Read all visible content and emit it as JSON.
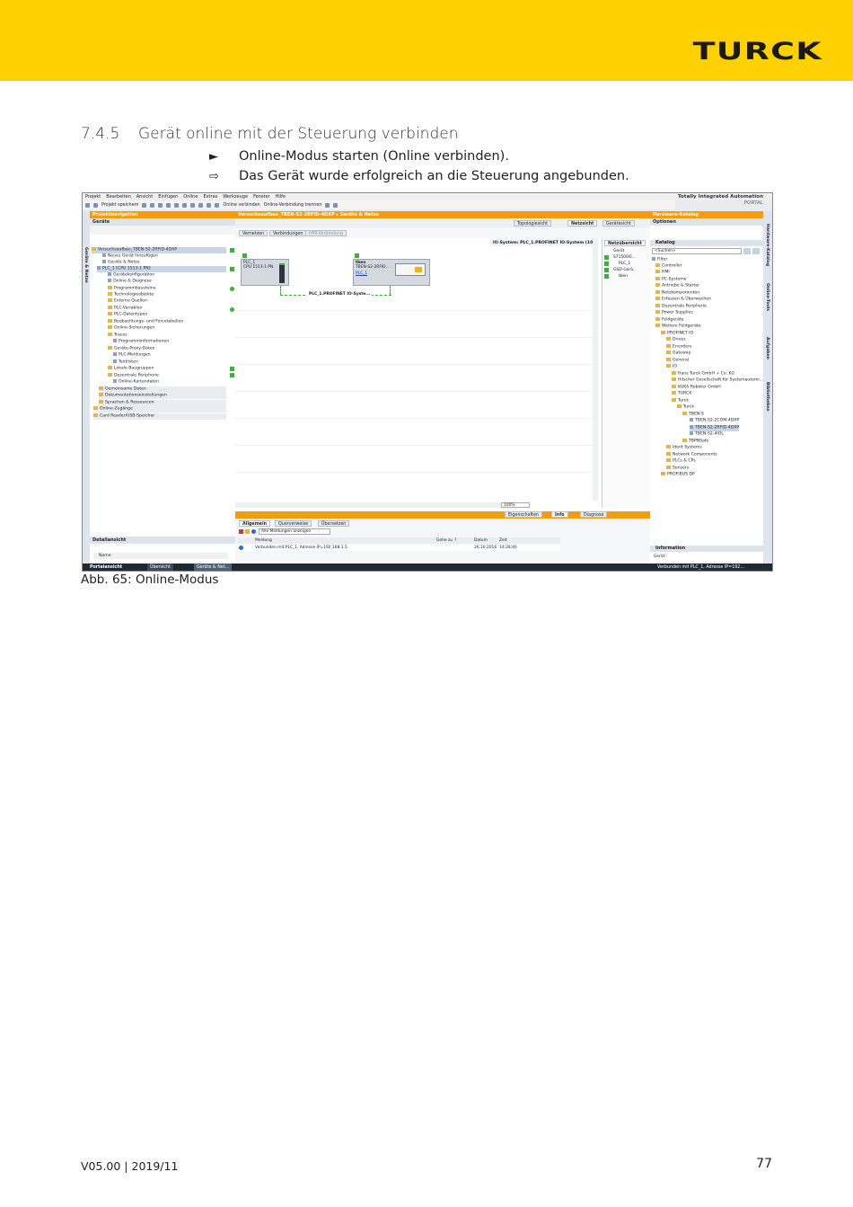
{
  "brand": {
    "logo": "TURCK"
  },
  "section": {
    "number": "7.4.5",
    "title": "Gerät online mit der Steuerung verbinden"
  },
  "steps": [
    {
      "marker": "►",
      "text": "Online-Modus starten (Online verbinden)."
    },
    {
      "marker": "⇨",
      "text": "Das Gerät wurde erfolgreich an die Steuerung angebunden."
    }
  ],
  "caption": "Abb. 65: Online-Modus",
  "footer": {
    "version": "V05.00 | 2019/11",
    "page": "77"
  },
  "screenshot": {
    "menu": [
      "Projekt",
      "Bearbeiten",
      "Ansicht",
      "Einfügen",
      "Online",
      "Extras",
      "Werkzeuge",
      "Fenster",
      "Hilfe"
    ],
    "brand_line1": "Totally Integrated Automation",
    "brand_line2": "PORTAL",
    "toolbar": {
      "save": "Projekt speichern",
      "connect": "Online verbinden",
      "disconnect": "Online-Verbindung trennen"
    },
    "project_nav": {
      "title": "Projektnavigation",
      "subtitle": "Geräte",
      "side_tab": "Geräte & Netze",
      "items": [
        "Versuchsaufbau_TBEN-S2-2RFID-4DXP",
        "Neues Gerät hinzufügen",
        "Geräte & Netze",
        "PLC_1 [CPU 1513-1 PN]",
        "Gerätekonfiguration",
        "Online & Diagnose",
        "Programmbausteine",
        "Technologieobjekte",
        "Externe Quellen",
        "PLC-Variablen",
        "PLC-Datentypen",
        "Beobachtungs- und Forcetabellen",
        "Online-Sicherungen",
        "Traces",
        "Programminformationen",
        "Geräte-Proxy-Daten",
        "PLC-Meldungen",
        "Textlisten",
        "Lokale Baugruppen",
        "Dezentrale Peripherie",
        "Online-Kartendaten",
        "Gemeinsame Daten",
        "Dokumentationseinstellungen",
        "Sprachen & Ressourcen",
        "Online-Zugänge",
        "Card Reader/USB-Speicher"
      ],
      "detail_title": "Detailansicht",
      "detail_col": "Name"
    },
    "editor": {
      "title": "Versuchsaufbau_TBEN-S2-2RFID-4DXP ▸ Geräte & Netze",
      "tabs": [
        "Topologiesicht",
        "Netzsicht",
        "Gerätesicht"
      ],
      "toolbar": [
        "Vernetzen",
        "Verbindungen",
        "HMI-Verbindung"
      ],
      "io_system": "IO-System: PLC_1.PROFINET IO-System (100)",
      "net_tab": "Netzübersicht",
      "net_col": "Gerät",
      "net_rows": [
        "S71500/E...",
        "PLC_1",
        "GSD-Gerä...",
        "tben"
      ],
      "plc_name": "PLC_1",
      "plc_type": "CPU 1513-1 PN",
      "tben_name": "tben",
      "tben_type": "TBEN-S2-2RFID...",
      "tben_link": "PLC_1",
      "profinet_label": "PLC_1.PROFINET IO-Syste...",
      "zoom": "100%"
    },
    "inspector": {
      "tabs": [
        "Eigenschaften",
        "Info",
        "Diagnose"
      ],
      "subtabs": [
        "Allgemein",
        "Querverweise",
        "Übersetzen"
      ],
      "filter": "Alle Meldungen anzeigen",
      "columns": [
        "Meldung",
        "Gehe zu",
        "?",
        "Datum",
        "Zeit"
      ],
      "message": "Verbunden mit PLC_1, Adresse IP=192.168.1.5.",
      "date": "26.10.2016",
      "time": "14:28:40"
    },
    "catalog": {
      "title": "Hardware-Katalog",
      "options": "Optionen",
      "section": "Katalog",
      "search": "<Suchen>",
      "filter": "Filter",
      "side_tabs": [
        "Hardware-Katalog",
        "Online-Tools",
        "Aufgaben",
        "Bibliotheken"
      ],
      "items": [
        "Controller",
        "HMI",
        "PC-Systeme",
        "Antriebe & Starter",
        "Netzkomponenten",
        "Erfassen & Überwachen",
        "Dezentrale Peripherie",
        "Power Supplies",
        "Feldgeräte",
        "Weitere Feldgeräte",
        "PROFINET IO",
        "Drives",
        "Encoders",
        "Gateway",
        "General",
        "IO",
        "Hans Turck GmbH + Co. KG",
        "Hilscher Gesellschaft für Systemautomi...",
        "KUKA Roboter GmbH",
        "TURCK",
        "Turck",
        "Turck",
        "TBEN-S",
        "TBEN-S2-2COM-4DXP",
        "TBEN-S2-2RFID-4DXP",
        "TBEN-S2-4IOL",
        "TBPNSafe",
        "Ident Systems",
        "Network Components",
        "PLCs & CPs",
        "Sensors",
        "PROFIBUS DP"
      ],
      "info": "Information",
      "info_row": "Gerät:"
    },
    "statusbar": {
      "portal": "Portalansicht",
      "overview": "Übersicht",
      "devices": "Geräte & Net...",
      "status": "Verbunden mit PLC_1, Adresse IP=192..."
    }
  }
}
